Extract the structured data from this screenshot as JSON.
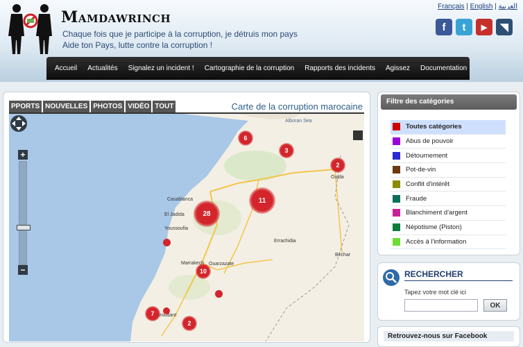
{
  "header": {
    "site_name": "Mamdawrinch",
    "tagline_1": "Chaque fois que je participe à la corruption, je détruis mon pays",
    "tagline_2": "Aide ton Pays, lutte contre la corruption !",
    "languages": [
      "Français",
      "English",
      "العربية"
    ],
    "separator": "|",
    "social": [
      {
        "icon": "facebook-icon",
        "glyph": "f",
        "color": "#3b5998"
      },
      {
        "icon": "twitter-icon",
        "glyph": "t",
        "color": "#3aa3d6"
      },
      {
        "icon": "youtube-icon",
        "glyph": "▶",
        "color": "#c4302b"
      },
      {
        "icon": "rss-icon",
        "glyph": "◥",
        "color": "#2d4f74"
      }
    ]
  },
  "nav": {
    "items": [
      "Accueil",
      "Actualités",
      "Signalez un incident !",
      "Cartographie de la corruption",
      "Rapports des incidents",
      "Agissez",
      "Documentation"
    ]
  },
  "map": {
    "tabs": [
      "PPORTS",
      "NOUVELLES",
      "PHOTOS",
      "VIDÉO",
      "TOUT"
    ],
    "title": "Carte de la corruption marocaine",
    "zoom_in": "+",
    "zoom_out": "−",
    "sea_label": "Alboran Sea",
    "city_labels": [
      "Casablanca",
      "Marrakech",
      "Taroudant",
      "Ouarzazate",
      "El Jadida",
      "Youssoufia",
      "Errachidia",
      "Béchar",
      "Oujda"
    ],
    "clusters": [
      {
        "count": "6",
        "size": "small"
      },
      {
        "count": "3",
        "size": "small"
      },
      {
        "count": "2",
        "size": "small"
      },
      {
        "count": "11",
        "size": "large"
      },
      {
        "count": "28",
        "size": "large"
      },
      {
        "count": "10",
        "size": "small"
      },
      {
        "count": "7",
        "size": "small"
      },
      {
        "count": "2",
        "size": "small"
      }
    ],
    "colors": {
      "sea": "#a9c7e6",
      "land": "#f3efe4",
      "cluster": "#d3252b",
      "road": "#f3c54b"
    }
  },
  "categories": {
    "title": "Filtre des catégories",
    "items": [
      {
        "label": "Toutes catégories",
        "color": "#cc0000",
        "active": true
      },
      {
        "label": "Abus de pouvoir",
        "color": "#9b00d9"
      },
      {
        "label": "Détournement",
        "color": "#2a2ad4"
      },
      {
        "label": "Pot-de-vin",
        "color": "#6b3a12"
      },
      {
        "label": "Conflit d'intérêt",
        "color": "#8c8c00"
      },
      {
        "label": "Fraude",
        "color": "#0a6e5c"
      },
      {
        "label": "Blanchiment d'argent",
        "color": "#c8219a"
      },
      {
        "label": "Népotisme (Piston)",
        "color": "#0b7c3b"
      },
      {
        "label": "Accès à l'information",
        "color": "#6cde34"
      }
    ]
  },
  "search": {
    "title": "RECHERCHER",
    "hint": "Tapez votre mot clé ici",
    "value": "",
    "button": "OK"
  },
  "facebook": {
    "label": "Retrouvez-nous sur Facebook"
  }
}
